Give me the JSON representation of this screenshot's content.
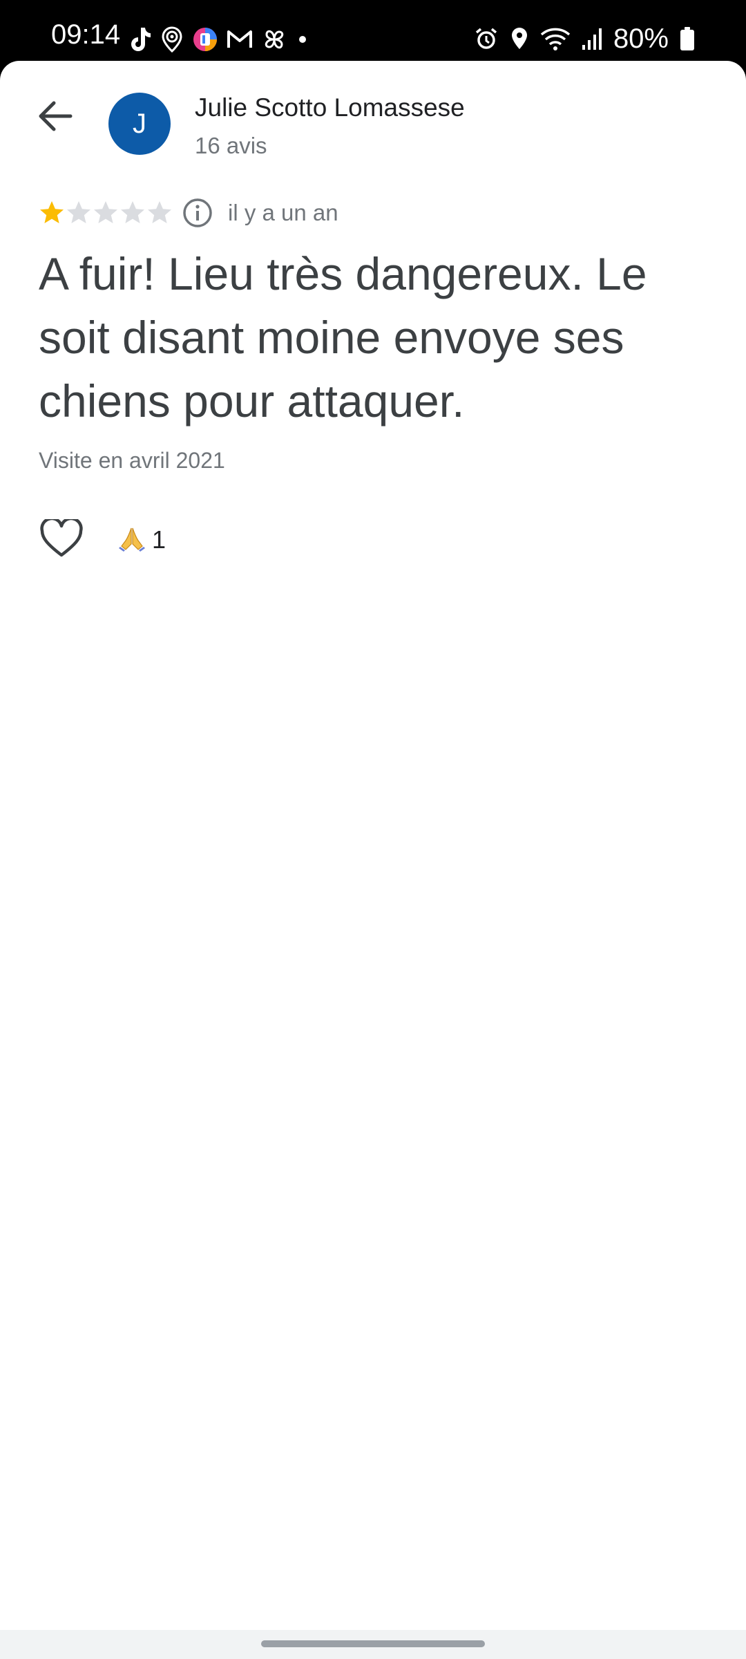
{
  "status_bar": {
    "time": "09:14",
    "battery": "80%",
    "notification_icons": [
      "tiktok-icon",
      "location-pin-icon",
      "colorful-app-icon",
      "gmail-icon",
      "pinwheel-icon",
      "dot-icon"
    ],
    "system_icons": [
      "alarm-icon",
      "location-icon",
      "wifi-icon",
      "signal-icon",
      "battery-icon"
    ]
  },
  "header": {
    "back_icon": "back-arrow-icon",
    "avatar_letter": "J",
    "avatar_color": "#0d5ba8",
    "reviewer_name": "Julie Scotto Lomassese",
    "review_count": "16 avis"
  },
  "review": {
    "rating": 1,
    "max_rating": 5,
    "star_filled_color": "#fbbc04",
    "star_empty_color": "#dadce0",
    "info_icon": "info-icon",
    "date": "il y a un an",
    "text": "A fuir! Lieu très dangereux. Le soit disant moine envoye ses chiens pour attaquer.",
    "visit": "Visite en avril 2021"
  },
  "actions": {
    "like_icon": "heart-icon",
    "reaction_icon": "folded-hands-icon",
    "reaction_count": "1"
  }
}
